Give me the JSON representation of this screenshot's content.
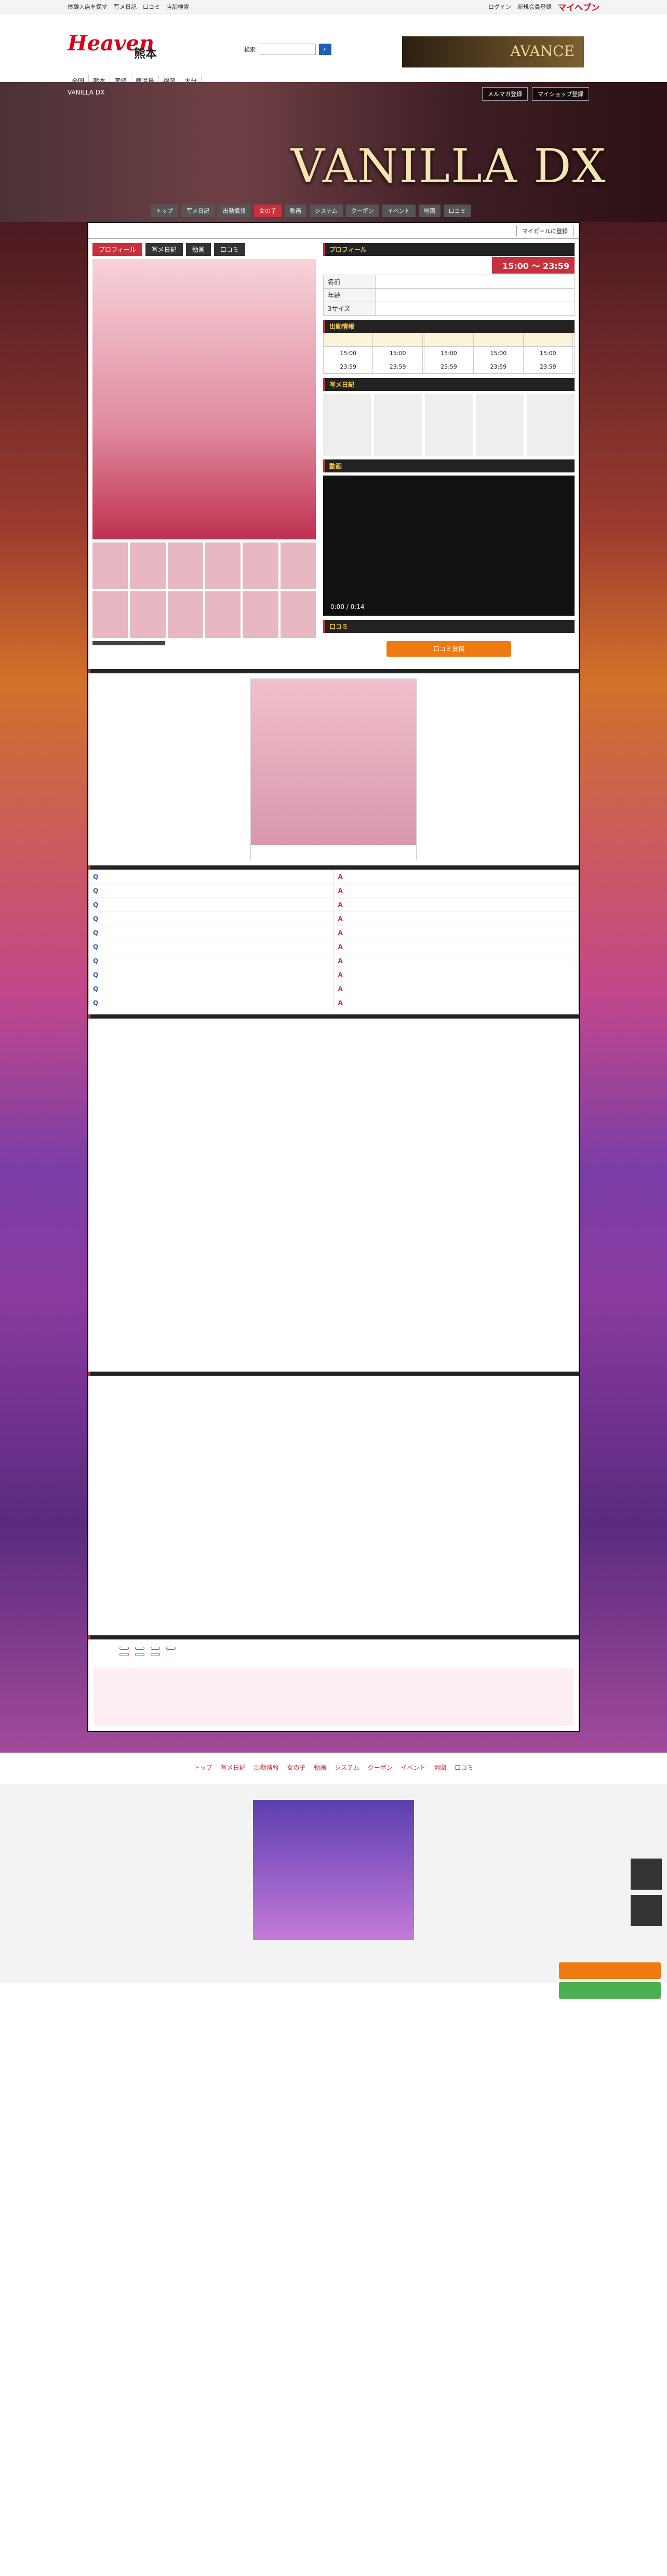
{
  "util": {
    "left": [
      "体験入店を探す",
      "写メ日記",
      "口コミ",
      "店舗検索"
    ],
    "brand": "マイヘブン",
    "right": [
      "ログイン",
      "新規会員登録"
    ]
  },
  "header": {
    "logo": "Heaven",
    "region": "熊本",
    "region_sub": "",
    "search_label": "検索",
    "search_placeholder": "",
    "nav": [
      "全国",
      "熊本",
      "宮崎",
      "鹿児島",
      "福岡",
      "大分"
    ],
    "ad_text": "AVANCE",
    "info_under": ""
  },
  "breadcrumb": "",
  "hero": {
    "store_line1": "VANILLA DX",
    "store_line2": "",
    "buttons": [
      "メルマガ登録",
      "マイショップ登録"
    ],
    "title": "VANILLA DX",
    "menu": [
      "トップ",
      "写メ日記",
      "出勤情報",
      "女の子",
      "動画",
      "システム",
      "クーポン",
      "イベント",
      "地図",
      "口コミ"
    ]
  },
  "girl": {
    "name": "",
    "badge": "",
    "my_button": "マイガールに登録",
    "tabs": [
      "プロフィール",
      "写メ日記",
      "動画",
      "口コミ"
    ],
    "photo_caption": "",
    "thumb_note": ""
  },
  "profile": {
    "header": "プロフィール",
    "today_label": "",
    "today_hours": "15:00 〜 23:59",
    "rows": [
      {
        "k": "名前",
        "v": ""
      },
      {
        "k": "年齢",
        "v": ""
      },
      {
        "k": "3サイズ",
        "v": ""
      }
    ]
  },
  "schedule": {
    "header": "出勤情報",
    "days": [
      "",
      "",
      "",
      "",
      "",
      "",
      ""
    ],
    "start": [
      "15:00",
      "15:00",
      "",
      "15:00",
      "15:00",
      "15:00",
      ""
    ],
    "end": [
      "23:59",
      "23:59",
      "",
      "23:59",
      "23:59",
      "23:59",
      ""
    ]
  },
  "diary": {
    "header": "写メ日記",
    "items": [
      "",
      "",
      "",
      "",
      ""
    ]
  },
  "video": {
    "header": "動画",
    "time": "0:00 / 0:14"
  },
  "review": {
    "header": "口コミ",
    "date": "",
    "title": "",
    "body": "",
    "button": "口コミ投稿"
  },
  "mh": {
    "header": "",
    "stamp": "",
    "date": "",
    "text": "",
    "more": ""
  },
  "qa": {
    "header": "",
    "items": [
      {
        "q": "",
        "a": ""
      },
      {
        "q": "",
        "a": ""
      },
      {
        "q": "",
        "a": ""
      },
      {
        "q": "",
        "a": ""
      },
      {
        "q": "",
        "a": ""
      },
      {
        "q": "",
        "a": ""
      },
      {
        "q": "",
        "a": ""
      },
      {
        "q": "",
        "a": ""
      },
      {
        "q": "",
        "a": ""
      },
      {
        "q": "",
        "a": ""
      }
    ]
  },
  "appeal": {
    "header": "",
    "text": ""
  },
  "shop_comment": {
    "header": "",
    "text": ""
  },
  "selling_points": {
    "header": "",
    "r1_label": "",
    "r1": [
      "",
      "",
      "",
      ""
    ],
    "r2_label": "",
    "r2": [
      "",
      "",
      ""
    ]
  },
  "cta": "",
  "footer_nav": [
    "トップ",
    "写メ日記",
    "出勤情報",
    "女の子",
    "動画",
    "システム",
    "クーポン",
    "イベント",
    "地図",
    "口コミ"
  ],
  "footer_note1": "",
  "footer_note2": "",
  "footer_links": "",
  "footer": {
    "ad": "",
    "h1": "",
    "grid": [
      {
        "k": "",
        "v": ""
      },
      {
        "k": "",
        "v": ""
      },
      {
        "k": "",
        "v": ""
      },
      {
        "k": "",
        "v": ""
      },
      {
        "k": "",
        "v": ""
      },
      {
        "k": "",
        "v": ""
      },
      {
        "k": "",
        "v": ""
      },
      {
        "k": "",
        "v": ""
      }
    ],
    "h2": "",
    "t2": "",
    "h3": "",
    "t3": "",
    "h4": "",
    "t4": "",
    "copy": ""
  },
  "side": [
    "",
    ""
  ],
  "mybtns": [
    "",
    ""
  ],
  "colors": {
    "accent": "#c9303e",
    "brand_red": "#d7001a",
    "link": "#1d5fb6"
  }
}
